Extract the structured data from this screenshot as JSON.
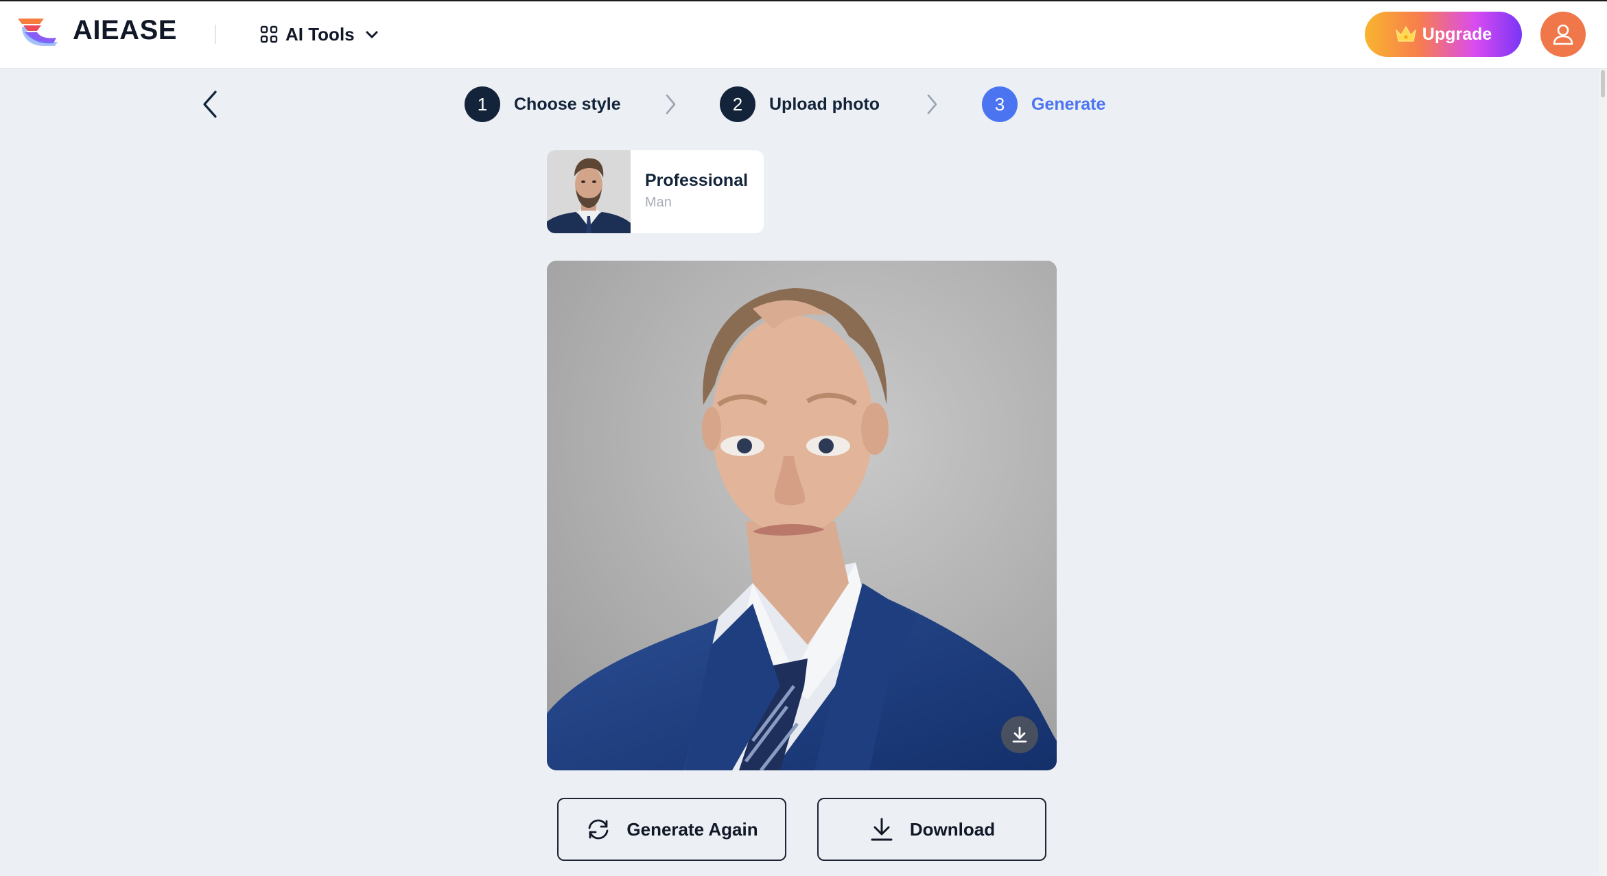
{
  "app": {
    "logo_text": "AIEASE",
    "brand_colors": {
      "logo_orange": "#f77d3f",
      "logo_red": "#ef4a5a",
      "logo_purple": "#8a5cf6",
      "logo_blue": "#5b8cf5"
    }
  },
  "header": {
    "menu_label": "AI Tools",
    "menu_icon": "grid-icon",
    "upgrade_label": "Upgrade",
    "upgrade_icon": "crown-icon",
    "avatar_icon": "user-icon"
  },
  "stepper": {
    "steps": [
      {
        "number": "1",
        "label": "Choose style",
        "state": "completed"
      },
      {
        "number": "2",
        "label": "Upload photo",
        "state": "completed"
      },
      {
        "number": "3",
        "label": "Generate",
        "state": "active"
      }
    ],
    "colors": {
      "done": "#13243a",
      "active": "#4b74f0"
    }
  },
  "style_card": {
    "name": "Professional",
    "subtitle": "Man",
    "thumbnail": "bearded-man-in-suit-portrait"
  },
  "result": {
    "image": "generated-professional-headshot-man-blue-suit",
    "overlay_icon": "download-icon"
  },
  "actions": {
    "generate_again_label": "Generate Again",
    "generate_again_icon": "refresh-icon",
    "download_label": "Download",
    "download_icon": "download-icon"
  }
}
